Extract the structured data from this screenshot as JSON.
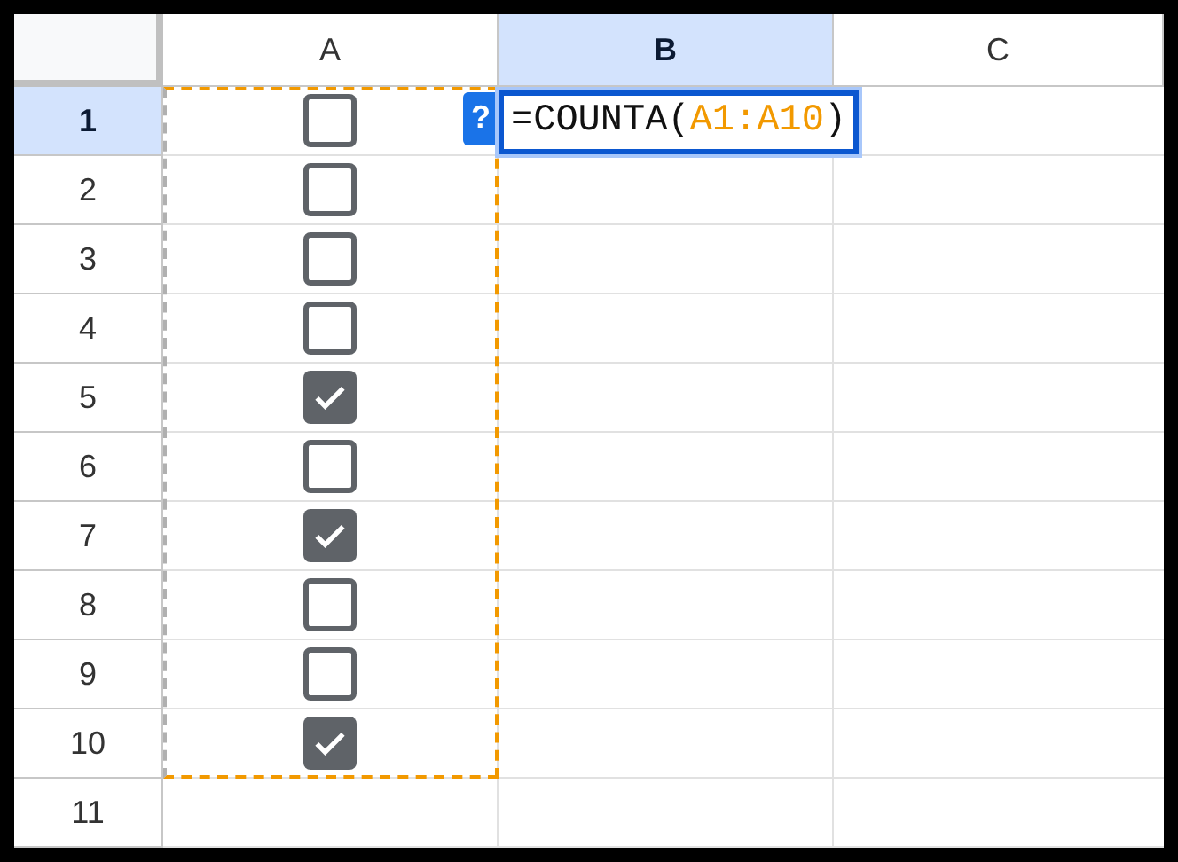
{
  "columns": [
    {
      "label": "A",
      "selected": false
    },
    {
      "label": "B",
      "selected": true
    },
    {
      "label": "C",
      "selected": false
    }
  ],
  "rows": [
    {
      "label": "1",
      "selected": true,
      "kind": "checkbox",
      "checked": false
    },
    {
      "label": "2",
      "selected": false,
      "kind": "checkbox",
      "checked": false
    },
    {
      "label": "3",
      "selected": false,
      "kind": "checkbox",
      "checked": false
    },
    {
      "label": "4",
      "selected": false,
      "kind": "checkbox",
      "checked": false
    },
    {
      "label": "5",
      "selected": false,
      "kind": "checkbox",
      "checked": true
    },
    {
      "label": "6",
      "selected": false,
      "kind": "checkbox",
      "checked": false
    },
    {
      "label": "7",
      "selected": false,
      "kind": "checkbox",
      "checked": true
    },
    {
      "label": "8",
      "selected": false,
      "kind": "checkbox",
      "checked": false
    },
    {
      "label": "9",
      "selected": false,
      "kind": "checkbox",
      "checked": false
    },
    {
      "label": "10",
      "selected": false,
      "kind": "checkbox",
      "checked": true
    },
    {
      "label": "11",
      "selected": false,
      "kind": "empty"
    }
  ],
  "formula": {
    "help": "?",
    "prefix": "=COUNTA(",
    "range": "A1:A10",
    "suffix": ")"
  }
}
